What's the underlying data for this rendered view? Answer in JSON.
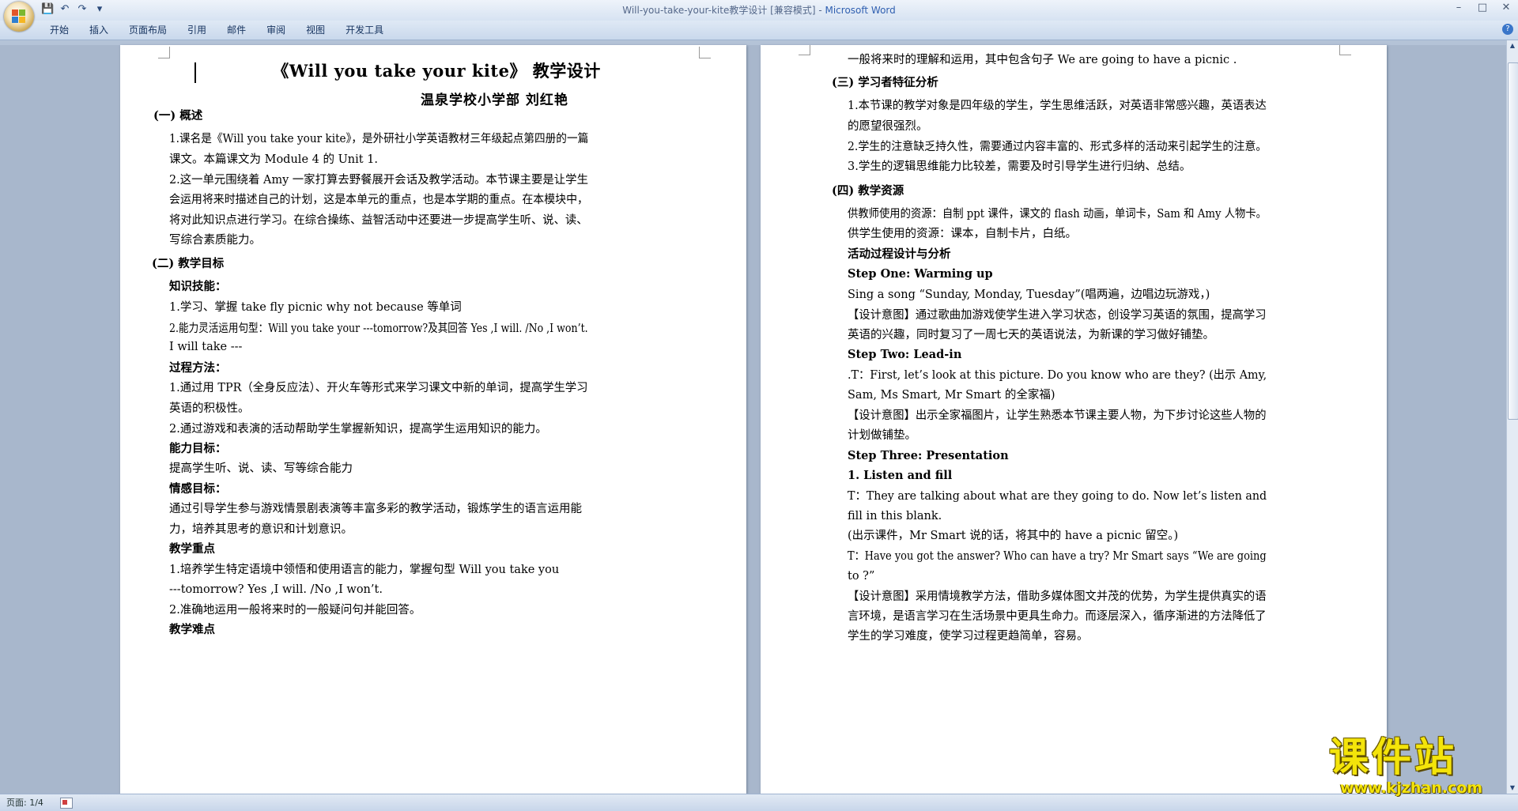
{
  "window": {
    "title_doc": "Will-you-take-your-kite教学设计 [兼容模式] - ",
    "title_app": "Microsoft Word"
  },
  "ribbon": {
    "tabs": [
      "开始",
      "插入",
      "页面布局",
      "引用",
      "邮件",
      "审阅",
      "视图",
      "开发工具"
    ]
  },
  "status": {
    "page": "页面: 1/4"
  },
  "watermark": {
    "text": "课件站",
    "url": "www.kjzhan.com"
  },
  "page1": {
    "title": "《Will you take your kite》 教学设计",
    "author": "温泉学校小学部 刘红艳",
    "lines": [
      "(一) 概述",
      "1.课名是《Will you take your kite》，是外研社小学英语教材三年级起点第四册的一篇",
      "课文。本篇课文为 Module 4 的 Unit 1. ",
      "2.这一单元围绕着 Amy 一家打算去野餐展开会话及教学活动。本节课主要是让学生",
      "会运用将来时描述自己的计划，这是本单元的重点，也是本学期的重点。在本模块中，",
      "将对此知识点进行学习。在综合操练、益智活动中还要进一步提高学生听、说、读、",
      "写综合素质能力。 ",
      "(二) 教学目标",
      "知识技能：",
      "1.学习、掌握 take fly picnic why not because 等单词",
      "2.能力灵活运用句型：Will you take your ---tomorrow?及其回答 Yes ,I will. /No ,I won’t.",
      "I will take ---",
      "过程方法：",
      "1.通过用 TPR（全身反应法）、开火车等形式来学习课文中新的单词，提高学生学习",
      "英语的积极性。 ",
      "2.通过游戏和表演的活动帮助学生掌握新知识，提高学生运用知识的能力。",
      "能力目标：",
      "提高学生听、说、读、写等综合能力",
      "情感目标：",
      "通过引导学生参与游戏情景剧表演等丰富多彩的教学活动，锻炼学生的语言运用能",
      "力，培养其思考的意识和计划意识。",
      "教学重点",
      "1.培养学生特定语境中领悟和使用语言的能力，掌握句型  Will  you  take  you",
      "---tomorrow? Yes ,I will. /No ,I won’t.",
      "2.准确地运用一般将来时的一般疑问句并能回答。",
      "教学难点"
    ]
  },
  "page2": {
    "lines": [
      "一般将来时的理解和运用，其中包含句子 We are going to have a picnic .",
      "(三) 学习者特征分析",
      "1.本节课的教学对象是四年级的学生，学生思维活跃，对英语非常感兴趣，英语表达",
      "的愿望很强烈。 ",
      "2.学生的注意缺乏持久性，需要通过内容丰富的、形式多样的活动来引起学生的注意。",
      "3.学生的逻辑思维能力比较差，需要及时引导学生进行归纳、总结。 ",
      "(四) 教学资源",
      "供教师使用的资源：自制 ppt 课件，课文的 flash 动画，单词卡，Sam 和 Amy 人物卡。",
      "供学生使用的资源：课本，自制卡片，白纸。",
      "活动过程设计与分析",
      "Step One: Warming up",
      "Sing  a  song  “Sunday,  Monday, Tuesday”(唱两遍，边唱边玩游戏，)",
      "【设计意图】通过歌曲加游戏使学生进入学习状态，创设学习英语的氛围，提高学习",
      "英语的兴趣，同时复习了一周七天的英语说法，为新课的学习做好铺垫。",
      "Step Two: Lead-in",
      ".T：First,  let’s  look  at  this  picture.  Do  you  know  who  are  they? (出示 Amy,",
      "Sam,  Ms  Smart,  Mr  Smart 的全家福)",
      "【设计意图】出示全家福图片，让学生熟悉本节课主要人物，为下步讨论这些人物的",
      "计划做铺垫。",
      "Step Three: Presentation ",
      "1.  Listen and fill",
      "T：They  are  talking  about  what  are  they  going  to  do.  Now  let’s  listen  and",
      "fill  in  this  blank.  ",
      "(出示课件，Mr Smart 说的话，将其中的 have a picnic 留空。)",
      "T：Have you got the answer? Who can have a try? Mr Smart says “We are going",
      "to ?” ",
      "【设计意图】采用情境教学方法，借助多媒体图文并茂的优势，为学生提供真实的语",
      "言环境，是语言学习在生活场景中更具生命力。而逐层深入，循序渐进的方法降低了",
      "学生的学习难度，使学习过程更趋简单，容易。"
    ]
  }
}
